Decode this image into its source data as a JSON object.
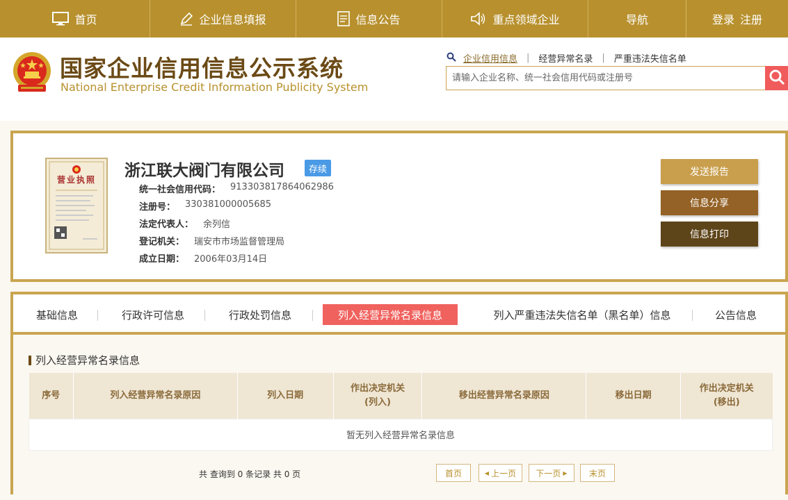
{
  "topnav": {
    "home": "首页",
    "fill_report": "企业信息填报",
    "announcement": "信息公告",
    "key_enterprises": "重点领域企业",
    "navigation": "导航",
    "login": "登录",
    "register": "注册"
  },
  "header": {
    "title": "国家企业信用信息公示系统",
    "subtitle": "National Enterprise Credit Information Publicity System",
    "search_links": [
      "企业信用信息",
      "经营异常名录",
      "严重违法失信名单"
    ],
    "search_placeholder": "请输入企业名称、统一社会信用代码或注册号"
  },
  "company": {
    "name": "浙江联大阀门有限公司",
    "status": "存续",
    "fields": [
      {
        "label": "统一社会信用代码：",
        "value": "913303817864062986"
      },
      {
        "label": "注册号：",
        "value": "330381000005685"
      },
      {
        "label": "法定代表人：",
        "value": "余列信"
      },
      {
        "label": "登记机关：",
        "value": "瑞安市市场监督管理局"
      },
      {
        "label": "成立日期：",
        "value": "2006年03月14日"
      }
    ],
    "license_text": "营业执照"
  },
  "actions": {
    "send_report": "发送报告",
    "share": "信息分享",
    "print": "信息打印"
  },
  "tabs": [
    "基础信息",
    "行政许可信息",
    "行政处罚信息",
    "列入经营异常名录信息",
    "列入严重违法失信名单（黑名单）信息",
    "公告信息"
  ],
  "active_tab": 3,
  "section": {
    "title": "列入经营异常名录信息",
    "columns": [
      [
        "序号"
      ],
      [
        "列入经营异常名录原因"
      ],
      [
        "列入日期"
      ],
      [
        "作出决定机关",
        "(列入)"
      ],
      [
        "移出经营异常名录原因"
      ],
      [
        "移出日期"
      ],
      [
        "作出决定机关",
        "(移出)"
      ]
    ],
    "empty_text": "暂无列入经营异常名录信息"
  },
  "pagination": {
    "summary": "共 查询到 0 条记录 共 0 页",
    "first": "首页",
    "prev": "上一页",
    "next": "下一页",
    "last": "末页"
  },
  "colors": {
    "gold": "#b8912e",
    "brown": "#6b4a16",
    "red": "#f05b5b",
    "blue_badge": "#4a9ae6"
  }
}
